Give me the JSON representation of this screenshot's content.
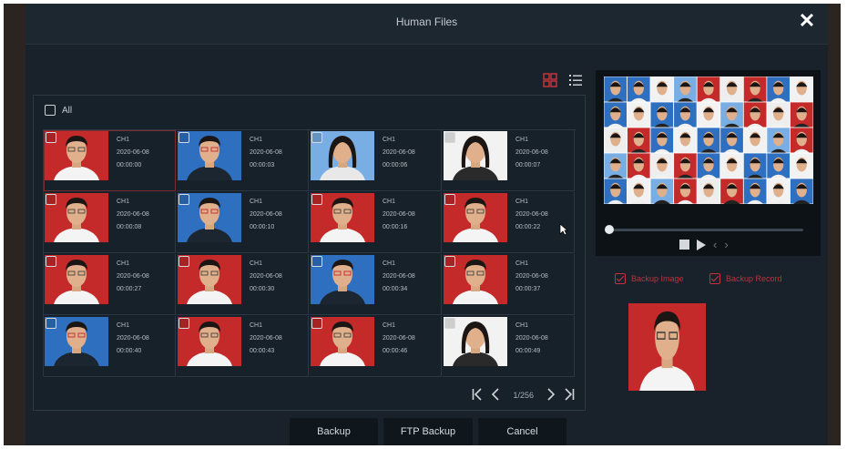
{
  "window": {
    "title": "Human Files"
  },
  "select_all_label": "All",
  "tiles": [
    {
      "channel": "CH1",
      "date": "2020-06-08",
      "time": "00:00:00",
      "bg": "#c42a2a",
      "face": "m",
      "selected": true
    },
    {
      "channel": "CH1",
      "date": "2020-06-08",
      "time": "00:00:03",
      "bg": "#2f6fc0",
      "face": "m2",
      "selected": false
    },
    {
      "channel": "CH1",
      "date": "2020-06-08",
      "time": "00:00:06",
      "bg": "#78aee3",
      "face": "f",
      "selected": false
    },
    {
      "channel": "CH1",
      "date": "2020-06-08",
      "time": "00:00:07",
      "bg": "#f2f2f2",
      "face": "f2",
      "selected": false
    },
    {
      "channel": "CH1",
      "date": "2020-06-08",
      "time": "00:00:08",
      "bg": "#c42a2a",
      "face": "m",
      "selected": false
    },
    {
      "channel": "CH1",
      "date": "2020-06-08",
      "time": "00:00:10",
      "bg": "#2f6fc0",
      "face": "m2",
      "selected": false
    },
    {
      "channel": "CH1",
      "date": "2020-06-08",
      "time": "00:00:16",
      "bg": "#c42a2a",
      "face": "m",
      "selected": false
    },
    {
      "channel": "CH1",
      "date": "2020-06-08",
      "time": "00:00:22",
      "bg": "#c42a2a",
      "face": "m",
      "selected": false
    },
    {
      "channel": "CH1",
      "date": "2020-06-08",
      "time": "00:00:27",
      "bg": "#c42a2a",
      "face": "m",
      "selected": false
    },
    {
      "channel": "CH1",
      "date": "2020-06-08",
      "time": "00:00:30",
      "bg": "#c42a2a",
      "face": "m",
      "selected": false
    },
    {
      "channel": "CH1",
      "date": "2020-06-08",
      "time": "00:00:34",
      "bg": "#2f6fc0",
      "face": "m2",
      "selected": false
    },
    {
      "channel": "CH1",
      "date": "2020-06-08",
      "time": "00:00:37",
      "bg": "#c42a2a",
      "face": "m",
      "selected": false
    },
    {
      "channel": "CH1",
      "date": "2020-06-08",
      "time": "00:00:40",
      "bg": "#2f6fc0",
      "face": "m2",
      "selected": false
    },
    {
      "channel": "CH1",
      "date": "2020-06-08",
      "time": "00:00:43",
      "bg": "#c42a2a",
      "face": "m",
      "selected": false
    },
    {
      "channel": "CH1",
      "date": "2020-06-08",
      "time": "00:00:46",
      "bg": "#c42a2a",
      "face": "m",
      "selected": false
    },
    {
      "channel": "CH1",
      "date": "2020-06-08",
      "time": "00:00:49",
      "bg": "#f2f2f2",
      "face": "f2",
      "selected": false
    }
  ],
  "pagination": {
    "text": "1/256"
  },
  "buttons": {
    "backup": "Backup",
    "ftp_backup": "FTP Backup",
    "cancel": "Cancel"
  },
  "options": {
    "backup_image": "Backup Image",
    "backup_record": "Backup Record"
  },
  "icons": [
    "close-icon",
    "grid-view-icon",
    "list-view-icon",
    "first-page-icon",
    "prev-page-icon",
    "next-page-icon",
    "last-page-icon",
    "stop-icon",
    "play-icon"
  ],
  "colors": {
    "accent_red": "#d2353d",
    "window_bg": "#19222a"
  }
}
